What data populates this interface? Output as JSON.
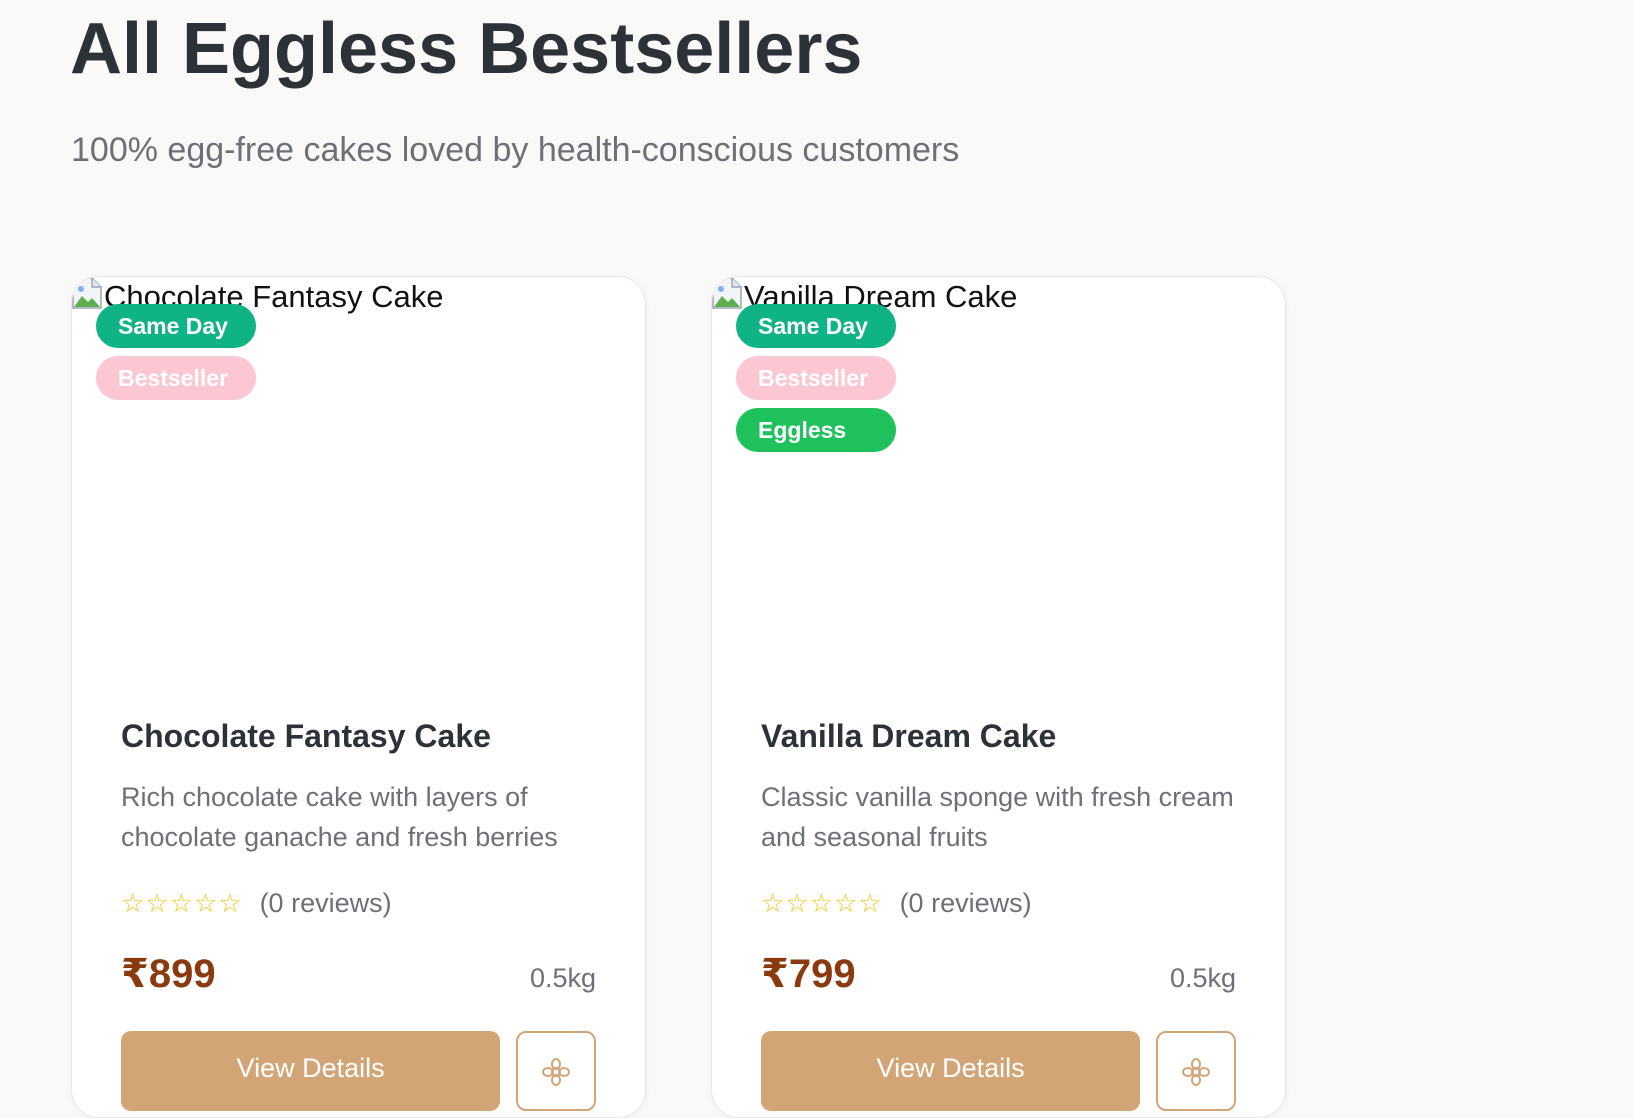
{
  "header": {
    "title": "All Eggless Bestsellers",
    "subtitle": "100% egg-free cakes loved by health-conscious customers"
  },
  "products": [
    {
      "image_alt": "Chocolate Fantasy Cake",
      "badges": [
        "Same Day",
        "Bestseller"
      ],
      "name": "Chocolate Fantasy Cake",
      "description": "Rich chocolate cake with layers of chocolate ganache and fresh berries",
      "rating_stars": 0,
      "reviews": "(0 reviews)",
      "price": "₹899",
      "weight": "0.5kg",
      "view_details_label": "View Details",
      "action_icon": "flower-icon"
    },
    {
      "image_alt": "Vanilla Dream Cake",
      "badges": [
        "Same Day",
        "Bestseller",
        "Eggless"
      ],
      "name": "Vanilla Dream Cake",
      "description": "Classic vanilla sponge with fresh cream and seasonal fruits",
      "rating_stars": 0,
      "reviews": "(0 reviews)",
      "price": "₹799",
      "weight": "0.5kg",
      "view_details_label": "View Details",
      "action_icon": "flower-icon"
    }
  ],
  "colors": {
    "same_day_badge": "#10b386",
    "bestseller_badge": "#fbc7d2",
    "eggless_badge": "#1fc15d",
    "price": "#8b3a10",
    "accent": "#d2a577",
    "star": "#f5c518"
  }
}
